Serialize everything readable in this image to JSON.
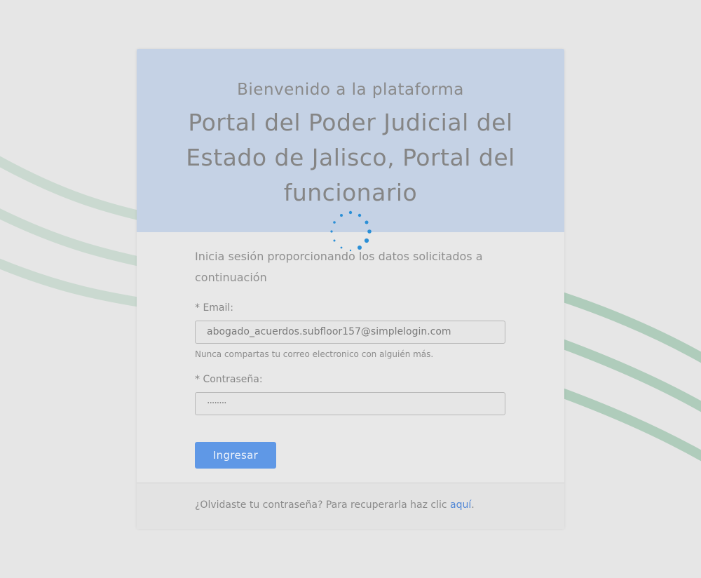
{
  "header": {
    "welcome": "Bienvenido a la plataforma",
    "title": "Portal del Poder Judicial del Estado de Jalisco, Portal del funcionario"
  },
  "form": {
    "intro": "Inicia sesión proporcionando los datos solicitados a continuación",
    "email_label": "* Email:",
    "email_value": "abogado_acuerdos.subfloor157@simplelogin.com",
    "email_hint": "Nunca compartas tu correo electronico con alguién más.",
    "password_label": "* Contraseña:",
    "password_value": "········",
    "submit_label": "Ingresar"
  },
  "footer": {
    "forgot_text": "¿Olvidaste tu contraseña? Para recuperarla haz clic ",
    "forgot_link": "aquí",
    "forgot_end": "."
  },
  "colors": {
    "header_bg": "#c5d2e5",
    "button_bg": "#5f98e6",
    "link": "#4f86d6",
    "wave": "#9fc5b0",
    "spinner": "#2b8fd6"
  }
}
